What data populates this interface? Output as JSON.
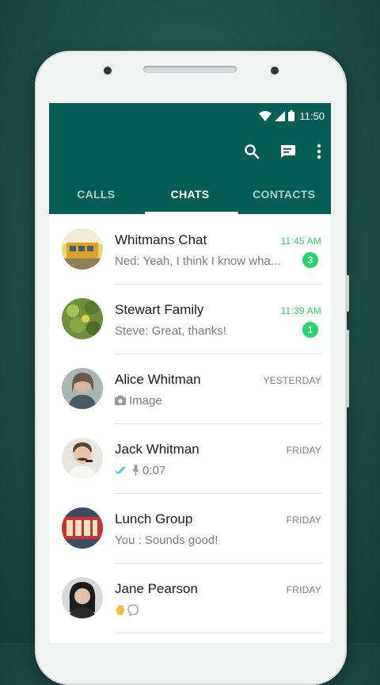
{
  "status_bar": {
    "time": "11:50"
  },
  "colors": {
    "primary": "#075e54",
    "accent": "#25d366"
  },
  "app_bar": {
    "icons": [
      "search-icon",
      "new-chat-icon",
      "more-vert-icon"
    ]
  },
  "tabs": [
    {
      "label": "CALLS",
      "active": false
    },
    {
      "label": "CHATS",
      "active": true
    },
    {
      "label": "CONTACTS",
      "active": false
    }
  ],
  "chats": [
    {
      "name": "Whitmans Chat",
      "time": "11:45 AM",
      "preview": "Ned: Yeah, I think I know wha...",
      "unread": "3"
    },
    {
      "name": "Stewart Family",
      "time": "11:39 AM",
      "preview": "Steve: Great, thanks!",
      "unread": "1"
    },
    {
      "name": "Alice Whitman",
      "time": "YESTERDAY",
      "preview": "Image",
      "preview_icon": "camera-icon"
    },
    {
      "name": "Jack Whitman",
      "time": "FRIDAY",
      "preview": "0:07",
      "preview_icon": "voice-note-icon"
    },
    {
      "name": "Lunch Group",
      "time": "FRIDAY",
      "preview": "You : Sounds good!"
    },
    {
      "name": "Jane Pearson",
      "time": "FRIDAY",
      "preview": "",
      "preview_icon": "emoji-icon"
    }
  ]
}
